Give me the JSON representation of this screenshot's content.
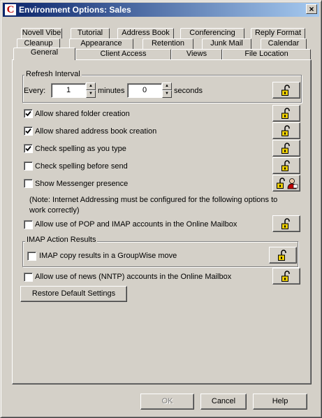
{
  "window": {
    "title": "Environment Options:  Sales",
    "app_icon": "C",
    "close_label": "×"
  },
  "tabs": {
    "row1": [
      "Novell Vibe",
      "Tutorial",
      "Address Book",
      "Conferencing",
      "Reply Format"
    ],
    "row2": [
      "Cleanup",
      "Appearance",
      "Retention",
      "Junk Mail",
      "Calendar"
    ],
    "row3": [
      "General",
      "Client Access",
      "Views",
      "File Location"
    ],
    "active": "General"
  },
  "refresh": {
    "group_title": "Refresh Interval",
    "every_label": "Every:",
    "minutes_value": "1",
    "minutes_label": "minutes",
    "seconds_value": "0",
    "seconds_label": "seconds"
  },
  "options": [
    {
      "label": "Allow shared folder creation",
      "checked": true
    },
    {
      "label": "Allow shared address book creation",
      "checked": true
    },
    {
      "label": "Check spelling as you type",
      "checked": true
    },
    {
      "label": "Check spelling before send",
      "checked": false
    },
    {
      "label": "Show Messenger presence",
      "checked": false
    }
  ],
  "note": "(Note: Internet Addressing must be configured for the following options to work correctly)",
  "pop_imap": {
    "label": "Allow use of POP and IMAP accounts in the Online Mailbox",
    "checked": false
  },
  "imap_action": {
    "group_title": "IMAP Action Results",
    "label": "IMAP copy results in a GroupWise move",
    "checked": false
  },
  "nntp": {
    "label": "Allow use of news (NNTP) accounts in the Online Mailbox",
    "checked": false
  },
  "restore_label": "Restore Default Settings",
  "footer": {
    "ok_label": "OK",
    "cancel_label": "Cancel",
    "help_label": "Help"
  },
  "icons": {
    "lock": "unlocked-padlock-icon",
    "person": "person-icon",
    "check": "checkmark-icon"
  },
  "colors": {
    "face": "#d4d0c8",
    "title_start": "#0a246a",
    "title_end": "#a6caf0",
    "lock_yellow": "#f0d000"
  }
}
